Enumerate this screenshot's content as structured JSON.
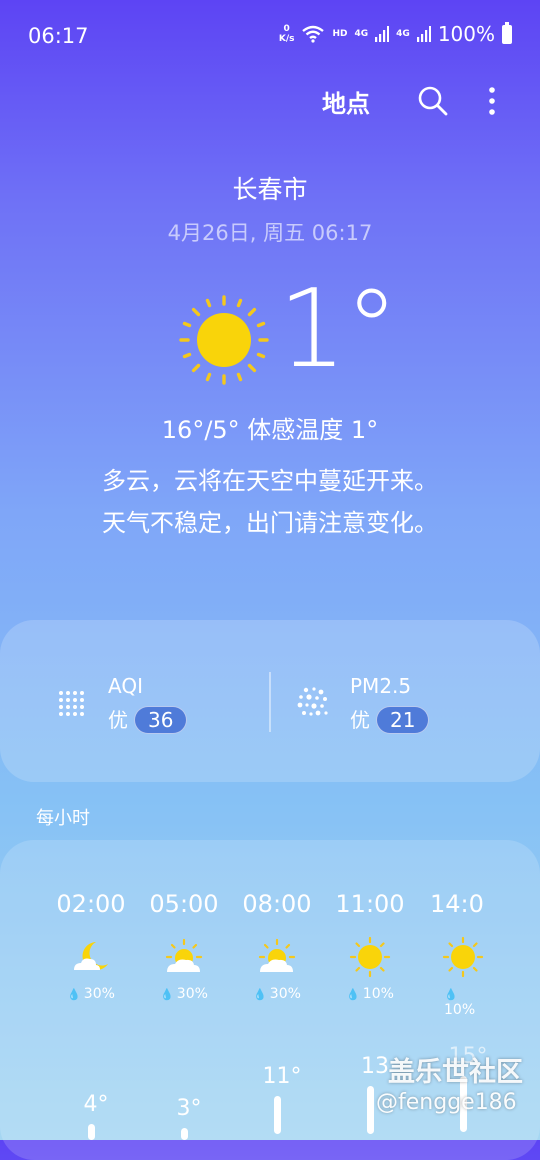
{
  "status_bar": {
    "time": "06:17",
    "netspeed_value": "0",
    "netspeed_unit": "K/s",
    "hd": "HD",
    "net1": "4G",
    "net2": "4G",
    "battery": "100%"
  },
  "actions": {
    "locations_label": "地点",
    "search_icon": "search-icon",
    "more_icon": "more-vert-icon"
  },
  "location": {
    "city": "长春市",
    "datetime": "4月26日, 周五 06:17"
  },
  "current": {
    "icon": "sunny-icon",
    "temperature": "1°",
    "range_feels": "16°/5° 体感温度 1°",
    "description_line1": "多云，云将在天空中蔓延开来。",
    "description_line2": "天气不稳定，出门请注意变化。"
  },
  "air_quality": {
    "aqi": {
      "label": "AQI",
      "level": "优",
      "value": "36",
      "icon": "aqi-dots-icon"
    },
    "pm25": {
      "label": "PM2.5",
      "level": "优",
      "value": "21",
      "icon": "pm25-dots-icon"
    }
  },
  "hourly": {
    "title": "每小时",
    "items": [
      {
        "time": "02:00",
        "icon": "moon-cloud-icon",
        "precip": "30%",
        "temp": "4°"
      },
      {
        "time": "05:00",
        "icon": "sun-cloud-icon",
        "precip": "30%",
        "temp": "3°"
      },
      {
        "time": "08:00",
        "icon": "sun-cloud-icon",
        "precip": "30%",
        "temp": "11°"
      },
      {
        "time": "11:00",
        "icon": "sunny-icon",
        "precip": "10%",
        "temp": "13"
      },
      {
        "time": "14:0",
        "icon": "sunny-icon",
        "precip": "10%",
        "temp": "15°"
      }
    ]
  },
  "watermark": {
    "line1": "盖乐世社区",
    "line2": "@fengge186"
  },
  "colors": {
    "sun": "#f9d40a",
    "sun_ray": "#f4c81c",
    "badge": "#4f7bd9"
  }
}
